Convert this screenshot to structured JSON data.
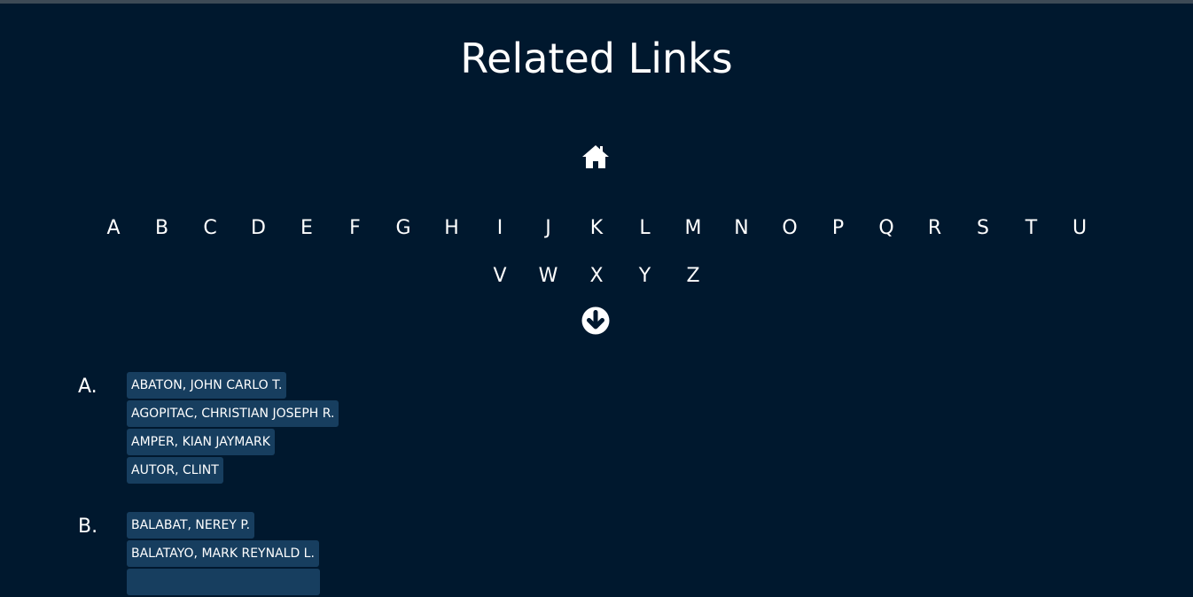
{
  "page": {
    "title": "Related Links"
  },
  "nav": {
    "home_icon": "home-icon",
    "down_icon": "arrow-circle-down-icon",
    "letters_row1": [
      "A",
      "B",
      "C",
      "D",
      "E",
      "F",
      "G",
      "H",
      "I",
      "J",
      "K",
      "L",
      "M",
      "N",
      "O",
      "P",
      "Q",
      "R",
      "S",
      "T",
      "U"
    ],
    "letters_row2": [
      "V",
      "W",
      "X",
      "Y",
      "Z"
    ]
  },
  "groups": [
    {
      "letter": "A.",
      "names": [
        "ABATON, JOHN CARLO T.",
        "AGOPITAC, CHRISTIAN JOSEPH R.",
        "AMPER, KIAN JAYMARK",
        "AUTOR, CLINT"
      ]
    },
    {
      "letter": "B.",
      "names": [
        "BALABAT, NEREY P.",
        "BALATAYO, MARK REYNALD L.",
        ""
      ]
    }
  ]
}
